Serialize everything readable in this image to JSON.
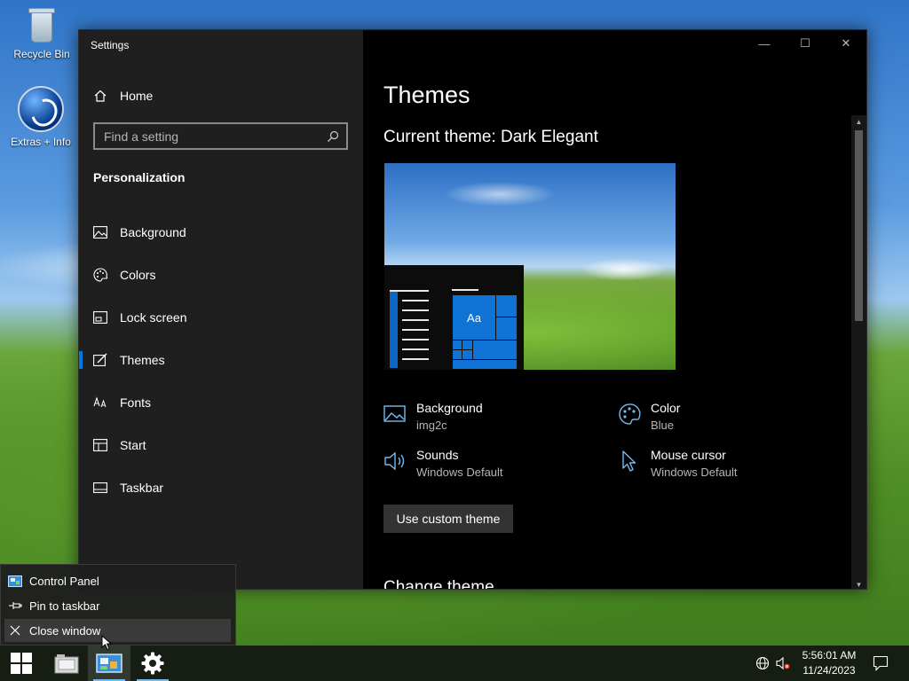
{
  "desktop": {
    "icons": [
      {
        "label": "Recycle Bin",
        "icon": "recycle-bin-icon"
      },
      {
        "label": "Extras + Info",
        "icon": "extras-info-icon"
      }
    ]
  },
  "window": {
    "title": "Settings",
    "controls": {
      "minimize": "—",
      "maximize": "☐",
      "close": "✕"
    }
  },
  "nav": {
    "home_label": "Home",
    "search_placeholder": "Find a setting",
    "section_title": "Personalization",
    "items": [
      {
        "label": "Background",
        "icon": "background-icon"
      },
      {
        "label": "Colors",
        "icon": "colors-icon"
      },
      {
        "label": "Lock screen",
        "icon": "lock-screen-icon"
      },
      {
        "label": "Themes",
        "icon": "themes-icon",
        "selected": true
      },
      {
        "label": "Fonts",
        "icon": "fonts-icon"
      },
      {
        "label": "Start",
        "icon": "start-icon"
      },
      {
        "label": "Taskbar",
        "icon": "taskbar-icon"
      }
    ]
  },
  "content": {
    "page_title": "Themes",
    "current_theme_label": "Current theme:",
    "current_theme_name": "Dark Elegant",
    "preview_tile_text": "Aa",
    "properties": {
      "background": {
        "label": "Background",
        "value": "img2c"
      },
      "color": {
        "label": "Color",
        "value": "Blue"
      },
      "sounds": {
        "label": "Sounds",
        "value": "Windows Default"
      },
      "mouse_cursor": {
        "label": "Mouse cursor",
        "value": "Windows Default"
      }
    },
    "custom_theme_button": "Use custom theme",
    "change_theme_heading": "Change theme"
  },
  "jumplist": {
    "items": [
      {
        "label": "Control Panel",
        "icon": "control-panel-icon"
      },
      {
        "label": "Pin to taskbar",
        "icon": "pin-icon"
      },
      {
        "label": "Close window",
        "icon": "close-icon",
        "hover": true
      }
    ]
  },
  "taskbar": {
    "time": "5:56:01 AM",
    "date": "11/24/2023"
  },
  "colors": {
    "accent": "#0078d7",
    "nav_bg": "#1f1f1f",
    "content_bg": "#000000"
  }
}
